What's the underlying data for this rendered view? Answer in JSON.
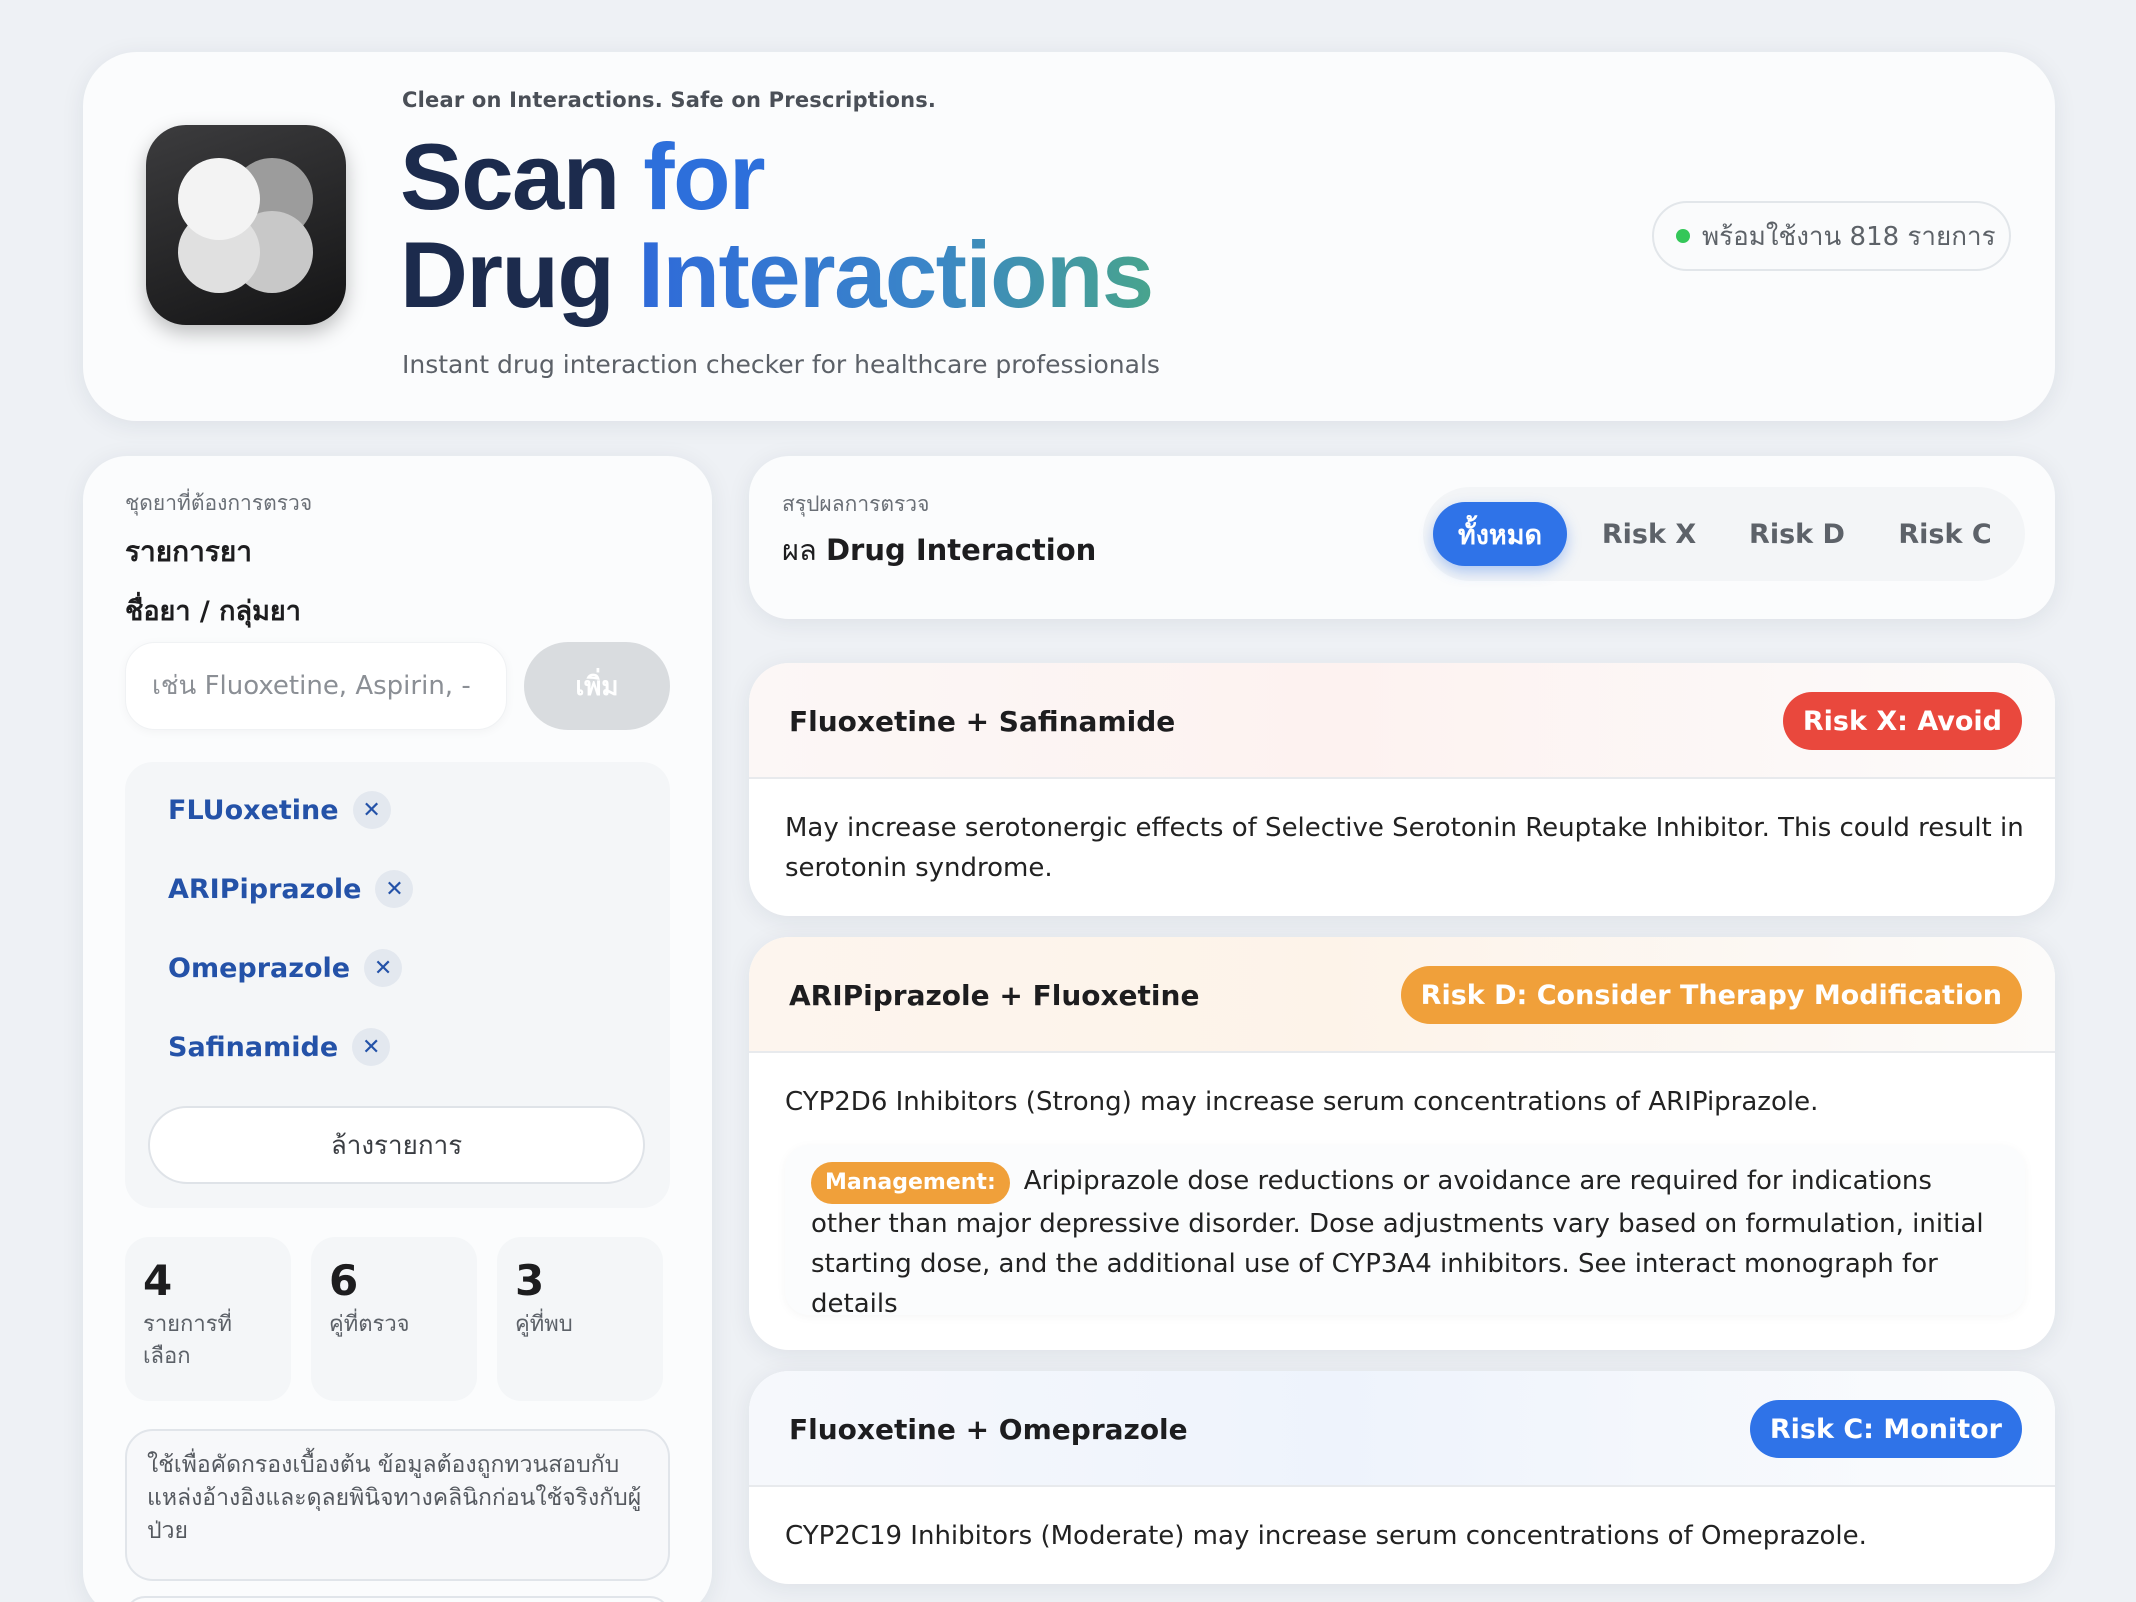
{
  "header": {
    "tagline": "Clear on Interactions. Safe on Prescriptions.",
    "title_line1_a": "Scan ",
    "title_line1_b": "for",
    "title_line2_a": "Drug ",
    "title_line2_b": "Interactions",
    "subtitle": "Instant drug interaction checker for healthcare professionals",
    "status": "พร้อมใช้งาน 818 รายการ",
    "status_color": "#34c759"
  },
  "left_panel": {
    "section_label": "ชุดยาที่ต้องการตรวจ",
    "section_title": "รายการยา",
    "field_label": "ชื่อยา / กลุ่มยา",
    "search_placeholder": "เช่น Fluoxetine, Aspirin, ‑",
    "add_label": "เพิ่ม",
    "chips": [
      "FLUoxetine",
      "ARIPiprazole",
      "Omeprazole",
      "Safinamide"
    ],
    "remove_icon": "close-icon",
    "clear_label": "ล้างรายการ",
    "stats": [
      {
        "value": "4",
        "label": "รายการที่เลือก"
      },
      {
        "value": "6",
        "label": "คู่ที่ตรวจ"
      },
      {
        "value": "3",
        "label": "คู่ที่พบ"
      }
    ],
    "disclaimer": "ใช้เพื่อคัดกรองเบื้องต้น ข้อมูลต้องถูกทวนสอบกับแหล่งอ้างอิงและดุลยพินิจทางคลินิกก่อนใช้จริงกับผู้ป่วย"
  },
  "summary": {
    "section_label": "สรุปผลการตรวจ",
    "title_prefix": "ผล ",
    "title_main": "Drug Interaction",
    "filters": [
      "ทั้งหมด",
      "Risk X",
      "Risk D",
      "Risk C"
    ],
    "active_filter": "ทั้งหมด"
  },
  "interactions": [
    {
      "pair": "Fluoxetine + Safinamide",
      "risk": "Risk X: Avoid",
      "risk_color": "#e9483d",
      "description": "May increase serotonergic effects of Selective Serotonin Reuptake Inhibitor. This could result in serotonin syndrome."
    },
    {
      "pair": "ARIPiprazole + Fluoxetine",
      "risk": "Risk D: Consider Therapy Modification",
      "risk_color": "#f0a03a",
      "description": "CYP2D6 Inhibitors (Strong) may increase serum concentrations of ARIPiprazole.",
      "management_label": "Management:",
      "management": "Aripiprazole dose reductions or avoidance are required for indications other than major depressive disorder. Dose adjustments vary based on formulation, initial starting dose, and the additional use of CYP3A4 inhibitors. See interact monograph for details"
    },
    {
      "pair": "Fluoxetine + Omeprazole",
      "risk": "Risk C: Monitor",
      "risk_color": "#2f73e8",
      "description": "CYP2C19 Inhibitors (Moderate) may increase serum concentrations of Omeprazole."
    }
  ]
}
